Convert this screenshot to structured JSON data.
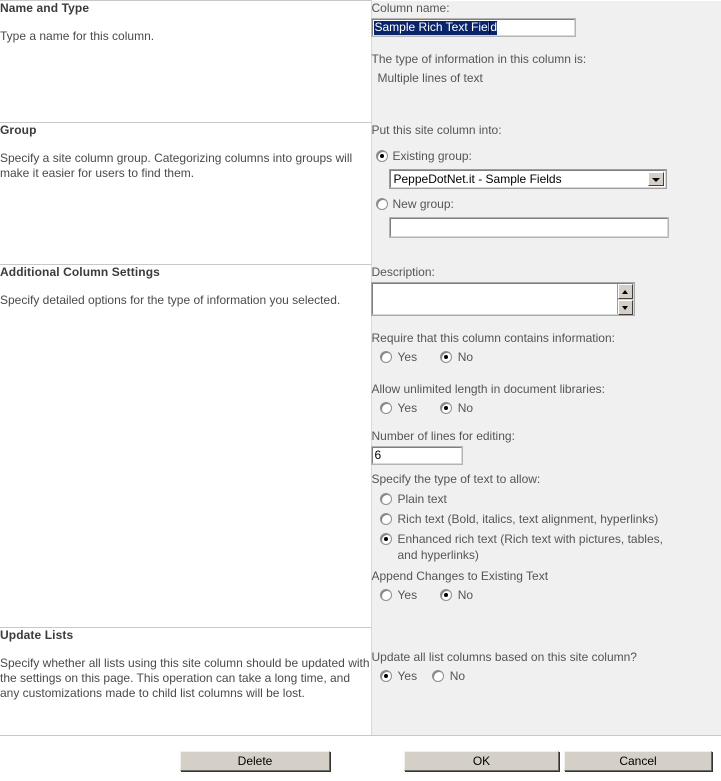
{
  "sections": [
    {
      "title": "Name and Type",
      "description": "Type a name for this column."
    },
    {
      "title": "Group",
      "description": "Specify a site column group. Categorizing columns into groups will make it easier for users to find them."
    },
    {
      "title": "Additional Column Settings",
      "description": "Specify detailed options for the type of information you selected."
    },
    {
      "title": "Update Lists",
      "description": "Specify whether all lists using this site column should be updated with the settings on this page. This operation can take a long time, and any customizations made to child list columns will be lost."
    }
  ],
  "name_and_type": {
    "column_name_label": "Column name:",
    "column_name_value": "Sample Rich Text Field",
    "type_label": "The type of information in this column is:",
    "type_value": "Multiple lines of text"
  },
  "group": {
    "prompt": "Put this site column into:",
    "existing_label": "Existing group:",
    "existing_selected": true,
    "existing_value": "PeppeDotNet.it - Sample Fields",
    "new_label": "New group:",
    "new_selected": false,
    "new_value": ""
  },
  "additional": {
    "description_label": "Description:",
    "description_value": "",
    "require_label": "Require that this column contains information:",
    "require_yes": "Yes",
    "require_no": "No",
    "require_value": "No",
    "unlimited_label": "Allow unlimited length in document libraries:",
    "unlimited_yes": "Yes",
    "unlimited_no": "No",
    "unlimited_value": "No",
    "lines_label": "Number of lines for editing:",
    "lines_value": "6",
    "text_type_label": "Specify the type of text to allow:",
    "text_type_options": [
      {
        "label": "Plain text",
        "selected": false
      },
      {
        "label": "Rich text (Bold, italics, text alignment, hyperlinks)",
        "selected": false
      },
      {
        "label": "Enhanced rich text (Rich text with pictures, tables, and hyperlinks)",
        "selected": true
      }
    ],
    "append_label": "Append Changes to Existing Text",
    "append_yes": "Yes",
    "append_no": "No",
    "append_value": "No"
  },
  "update_lists": {
    "prompt": "Update all list columns based on this site column?",
    "yes": "Yes",
    "no": "No",
    "value": "Yes"
  },
  "footer": {
    "delete_label": "Delete",
    "ok_label": "OK",
    "cancel_label": "Cancel"
  },
  "colors": {
    "panel_bg": "#f0f0f0",
    "page_bg": "#ffffff",
    "selection_blue": "#0a246a",
    "button_face": "#d4d0c8"
  }
}
